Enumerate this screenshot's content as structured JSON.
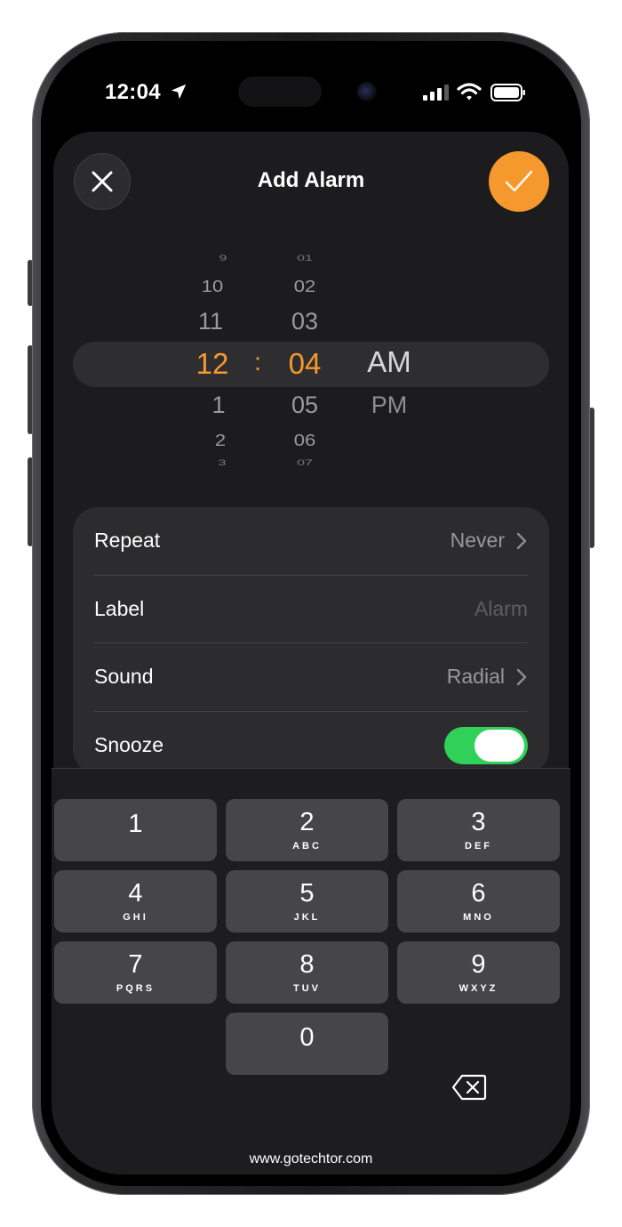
{
  "status_bar": {
    "time": "12:04"
  },
  "header": {
    "title": "Add Alarm"
  },
  "picker": {
    "hours": [
      "9",
      "10",
      "11",
      "12",
      "1",
      "2",
      "3"
    ],
    "minutes": [
      "01",
      "02",
      "03",
      "04",
      "05",
      "06",
      "07"
    ],
    "selected_hour": "12",
    "selected_minute": "04",
    "separator": ":",
    "periods": [
      "AM",
      "PM"
    ],
    "selected_period": "AM",
    "accent_color": "#f5982d"
  },
  "settings": {
    "repeat": {
      "label": "Repeat",
      "value": "Never"
    },
    "label": {
      "label": "Label",
      "placeholder": "Alarm"
    },
    "sound": {
      "label": "Sound",
      "value": "Radial"
    },
    "snooze": {
      "label": "Snooze",
      "enabled": true,
      "on_color": "#30d158"
    }
  },
  "keypad": {
    "keys": [
      {
        "digit": "1",
        "letters": ""
      },
      {
        "digit": "2",
        "letters": "ABC"
      },
      {
        "digit": "3",
        "letters": "DEF"
      },
      {
        "digit": "4",
        "letters": "GHI"
      },
      {
        "digit": "5",
        "letters": "JKL"
      },
      {
        "digit": "6",
        "letters": "MNO"
      },
      {
        "digit": "7",
        "letters": "PQRS"
      },
      {
        "digit": "8",
        "letters": "TUV"
      },
      {
        "digit": "9",
        "letters": "WXYZ"
      },
      {
        "digit": "0",
        "letters": ""
      }
    ],
    "delete_icon": "backspace-icon"
  },
  "footer": {
    "watermark": "www.gotechtor.com"
  }
}
